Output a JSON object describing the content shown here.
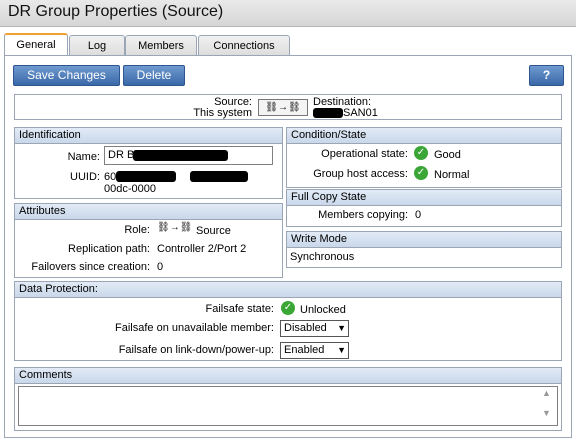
{
  "window": {
    "title": "DR Group Properties (Source)"
  },
  "tabs": [
    {
      "label": "General",
      "active": true
    },
    {
      "label": "Log",
      "active": false
    },
    {
      "label": "Members",
      "active": false
    },
    {
      "label": "Connections",
      "active": false
    }
  ],
  "toolbar": {
    "save_label": "Save Changes",
    "delete_label": "Delete",
    "help_label": "?"
  },
  "replication": {
    "source_label": "Source:",
    "source_value": "This system",
    "destination_label": "Destination:",
    "destination_value": "SAN01"
  },
  "identification": {
    "header": "Identification",
    "name_label": "Name:",
    "name_value": "DR B",
    "uuid_label": "UUID:",
    "uuid_line1": "60 d- -2000-",
    "uuid_line2": "00dc-0000"
  },
  "attributes": {
    "header": "Attributes",
    "role_label": "Role:",
    "role_value": "Source",
    "path_label": "Replication path:",
    "path_value": "Controller 2/Port 2",
    "failovers_label": "Failovers since creation:",
    "failovers_value": "0"
  },
  "condition": {
    "header": "Condition/State",
    "operational_label": "Operational state:",
    "operational_value": "Good",
    "host_access_label": "Group host access:",
    "host_access_value": "Normal"
  },
  "full_copy": {
    "header": "Full Copy State",
    "members_label": "Members copying:",
    "members_value": "0"
  },
  "write_mode": {
    "header": "Write Mode",
    "value": "Synchronous"
  },
  "data_protection": {
    "header": "Data Protection:",
    "failsafe_state_label": "Failsafe state:",
    "failsafe_state_value": "Unlocked",
    "unavailable_label": "Failsafe on unavailable member:",
    "unavailable_value": "Disabled",
    "linkdown_label": "Failsafe on link-down/power-up:",
    "linkdown_value": "Enabled"
  },
  "comments": {
    "header": "Comments",
    "value": ""
  },
  "colors": {
    "accent_tab": "#f0a030",
    "button": "#4a78b8",
    "ok_green": "#3aa635",
    "panel_header": "#d3dff0"
  }
}
